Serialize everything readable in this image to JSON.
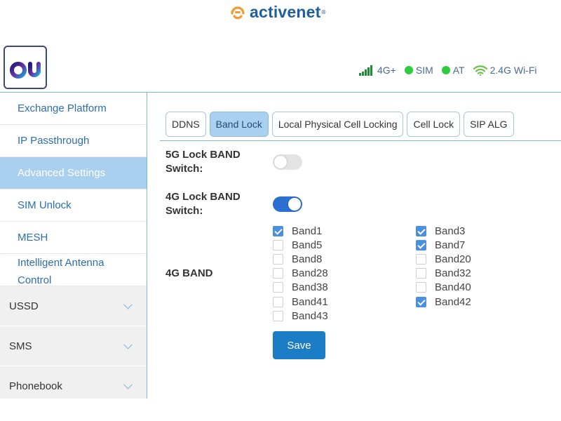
{
  "brand": {
    "name": "activenet",
    "mark": "®",
    "icon": "activenet-logo-icon",
    "color": "#f29a2e"
  },
  "header": {
    "logo": "du-logo",
    "status": {
      "network": "4G+",
      "sim": "SIM",
      "at": "AT",
      "wifi": "2.4G Wi-Fi"
    }
  },
  "sidebar": {
    "items": [
      {
        "label": "Exchange Platform",
        "active": false
      },
      {
        "label": "IP Passthrough",
        "active": false
      },
      {
        "label": "Advanced Settings",
        "active": true
      },
      {
        "label": "SIM Unlock",
        "active": false
      },
      {
        "label": "MESH",
        "active": false
      },
      {
        "label": "Intelligent Antenna Control",
        "active": false
      }
    ],
    "groups": [
      {
        "label": "USSD"
      },
      {
        "label": "SMS"
      },
      {
        "label": "Phonebook"
      }
    ]
  },
  "tabs": [
    {
      "label": "DDNS",
      "active": false
    },
    {
      "label": "Band Lock",
      "active": true
    },
    {
      "label": "Local Physical Cell Locking",
      "active": false
    },
    {
      "label": "Cell Lock",
      "active": false
    },
    {
      "label": "SIP ALG",
      "active": false
    }
  ],
  "form": {
    "lock5g_label": "5G Lock BAND Switch:",
    "lock5g_on": false,
    "lock4g_label": "4G Lock BAND Switch:",
    "lock4g_on": true,
    "band_label": "4G BAND",
    "bands_left": [
      {
        "label": "Band1",
        "checked": true
      },
      {
        "label": "Band5",
        "checked": false
      },
      {
        "label": "Band8",
        "checked": false
      },
      {
        "label": "Band28",
        "checked": false
      },
      {
        "label": "Band38",
        "checked": false
      },
      {
        "label": "Band41",
        "checked": false
      },
      {
        "label": "Band43",
        "checked": false
      }
    ],
    "bands_right": [
      {
        "label": "Band3",
        "checked": true
      },
      {
        "label": "Band7",
        "checked": true
      },
      {
        "label": "Band20",
        "checked": false
      },
      {
        "label": "Band32",
        "checked": false
      },
      {
        "label": "Band40",
        "checked": false
      },
      {
        "label": "Band42",
        "checked": true
      }
    ],
    "save_label": "Save"
  },
  "colors": {
    "accent": "#1c7dc7",
    "active_bg": "#a9d0ef",
    "switch_on": "#2c6fd1",
    "status_green": "#2ecc40",
    "signal_green": "#1f8a3a"
  }
}
